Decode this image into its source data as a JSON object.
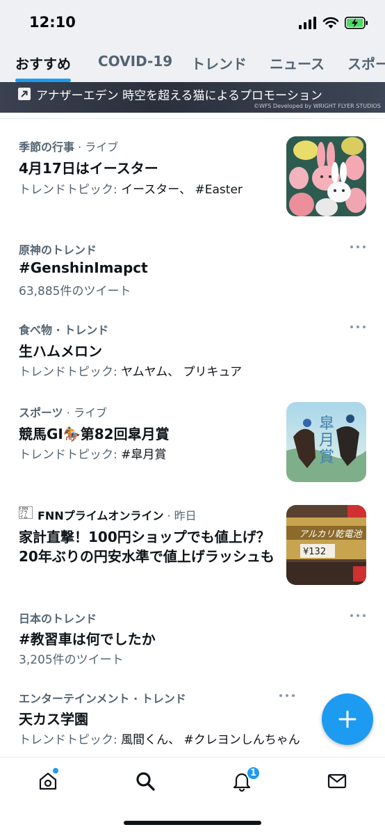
{
  "status_bar": {
    "time": "12:10"
  },
  "tabs": [
    {
      "label": "おすすめ",
      "active": true
    },
    {
      "label": "COVID-19"
    },
    {
      "label": "トレンド"
    },
    {
      "label": "ニュース"
    },
    {
      "label": "スポー"
    }
  ],
  "promo": {
    "text": "アナザーエデン 時空を超える猫によるプロモーション",
    "credit": "©WFS Developed by WRIGHT FLYER STUDIOS"
  },
  "trends": [
    {
      "category": "季節の行事",
      "suffix": "· ライブ",
      "title": "4月17日はイースター",
      "sub_prefix": "トレンドトピック:",
      "sub_value": "イースター、 #Easter",
      "thumbnail": "easter-cookies"
    },
    {
      "category": "原神のトレンド",
      "title": "#GenshinImapct",
      "sub_value": "63,885件のツイート",
      "has_more": true
    },
    {
      "category": "食べ物 · トレンド",
      "title": "生ハムメロン",
      "sub_prefix": "トレンドトピック:",
      "sub_value": "ヤムヤム、 プリキュア",
      "has_more": true
    },
    {
      "category": "スポーツ",
      "suffix": "· ライブ",
      "title": "競馬GI🏇第82回皐月賞",
      "sub_prefix": "トレンドトピック:",
      "sub_value": "#皐月賞",
      "thumbnail": "satsuki-sho-horses"
    },
    {
      "source_logo": "FNN プライム オンライン",
      "category": "FNNプライムオンライン",
      "suffix": "· 昨日",
      "title_line1": "家計直撃！100円ショップでも値上げ？",
      "title_line2": "20年ぶりの円安水準で値上げラッシュも",
      "thumbnail": "battery-price-tag",
      "thumbnail_text": "¥132"
    },
    {
      "category": "日本のトレンド",
      "title": "#教習車は何でしたか",
      "sub_value": "3,205件のツイート",
      "has_more": true
    },
    {
      "category": "エンターテインメント · トレンド",
      "title": "天カス学園",
      "sub_prefix": "トレンドトピック:",
      "sub_value": "風間くん、 #クレヨンしんちゃん",
      "has_more": true
    }
  ],
  "bottom_nav": {
    "items": [
      "home-icon",
      "search-icon",
      "bell-icon",
      "mail-icon"
    ],
    "notifications_badge": "1"
  },
  "colors": {
    "accent": "#1d9bf0",
    "text": "#0f1419",
    "muted": "#536471"
  }
}
